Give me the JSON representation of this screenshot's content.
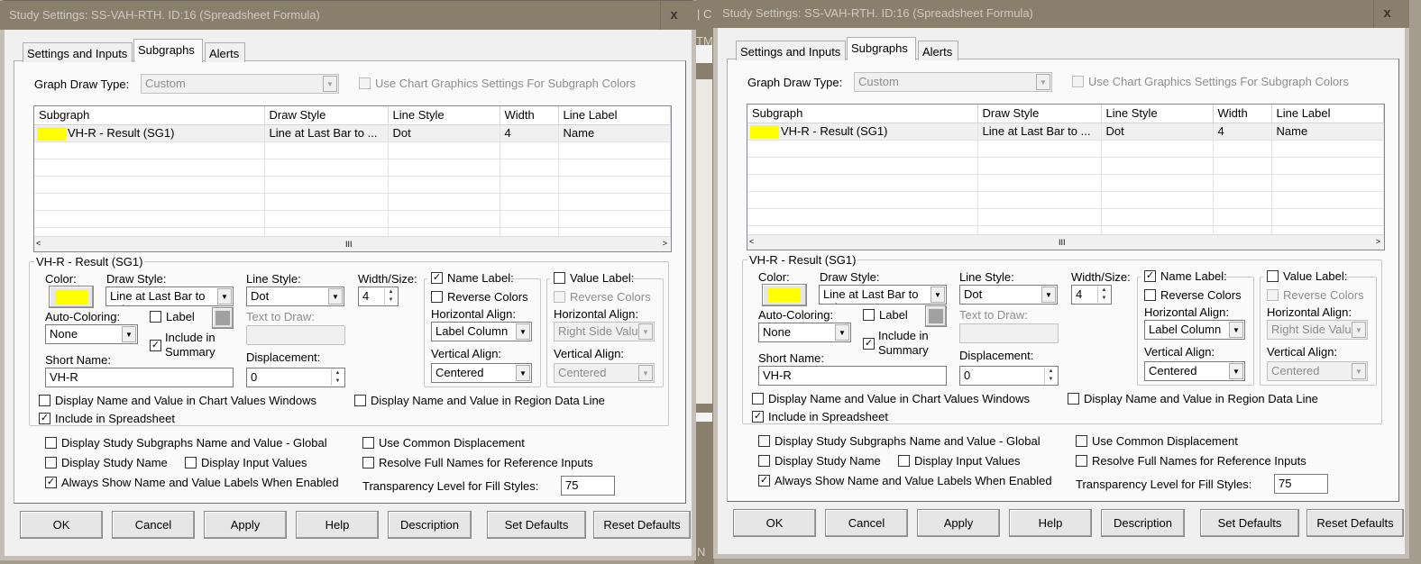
{
  "background_app": {
    "fragments": [
      "| C",
      "TM",
      "N"
    ]
  },
  "dialog": {
    "title": "Study Settings: SS-VAH-RTH. ID:16 (Spreadsheet Formula)",
    "close_label": "x",
    "tabs": [
      {
        "label": "Settings and Inputs",
        "selected": false
      },
      {
        "label": "Subgraphs",
        "selected": true
      },
      {
        "label": "Alerts",
        "selected": false
      }
    ],
    "graph_draw_type": {
      "label": "Graph Draw Type:",
      "value": "Custom",
      "disabled": true
    },
    "use_chart_graphics": {
      "label": "Use Chart Graphics Settings For Subgraph Colors",
      "checked": false,
      "disabled": true
    },
    "table": {
      "columns": [
        "Subgraph",
        "Draw Style",
        "Line Style",
        "Width",
        "Line Label"
      ],
      "rows": [
        {
          "color": "#ffff00",
          "subgraph": "VH-R - Result (SG1)",
          "draw_style": "Line at Last Bar to ...",
          "line_style": "Dot",
          "width": "4",
          "line_label": "Name"
        }
      ],
      "scroll_grip": "III"
    },
    "group": {
      "title": "VH-R - Result (SG1)",
      "color_label": "Color:",
      "color": "#ffff00",
      "draw_style_label": "Draw Style:",
      "draw_style": "Line at Last Bar to Edge",
      "line_style_label": "Line Style:",
      "line_style": "Dot",
      "width_label": "Width/Size:",
      "width": "4",
      "auto_coloring_label": "Auto-Coloring:",
      "auto_coloring": "None",
      "label_checkbox": {
        "label": "Label",
        "checked": false
      },
      "label_color": "#a0a0a0",
      "text_to_draw_label": "Text to Draw:",
      "text_to_draw": "",
      "include_summary": {
        "label_1": "Include in",
        "label_2": "Summary",
        "checked": true
      },
      "short_name_label": "Short Name:",
      "short_name": "VH-R",
      "displacement_label": "Displacement:",
      "displacement": "0",
      "name_label": {
        "label": "Name Label:",
        "checked": true,
        "reverse_colors": "Reverse Colors",
        "reverse_checked": false,
        "h_align_label": "Horizontal Align:",
        "h_align": "Label Column",
        "v_align_label": "Vertical Align:",
        "v_align": "Centered"
      },
      "value_label": {
        "label": "Value Label:",
        "checked": false,
        "reverse_colors": "Reverse Colors",
        "reverse_checked": false,
        "h_align_label": "Horizontal Align:",
        "h_align": "Right Side Value",
        "v_align_label": "Vertical Align:",
        "v_align": "Centered"
      },
      "display_chart_values": {
        "label": "Display Name and Value in Chart Values Windows",
        "checked": false
      },
      "display_region_data": {
        "label": "Display Name and Value in Region Data Line",
        "checked": false
      },
      "include_spreadsheet": {
        "label": "Include in Spreadsheet",
        "checked": true
      }
    },
    "global": {
      "display_subgraphs_global": {
        "label": "Display Study Subgraphs Name and Value - Global",
        "checked": false
      },
      "use_common_displacement": {
        "label": "Use Common Displacement",
        "checked": false
      },
      "display_study_name": {
        "label": "Display Study Name",
        "checked": false
      },
      "display_input_values": {
        "label": "Display Input Values",
        "checked": false
      },
      "resolve_full_names": {
        "label": "Resolve Full Names for Reference Inputs",
        "checked": false
      },
      "always_show_labels": {
        "label": "Always Show Name and Value Labels When Enabled",
        "checked": true
      },
      "transparency_label": "Transparency Level for Fill Styles:",
      "transparency": "75"
    },
    "buttons": [
      "OK",
      "Cancel",
      "Apply",
      "Help",
      "Description",
      "Set Defaults",
      "Reset Defaults"
    ]
  }
}
